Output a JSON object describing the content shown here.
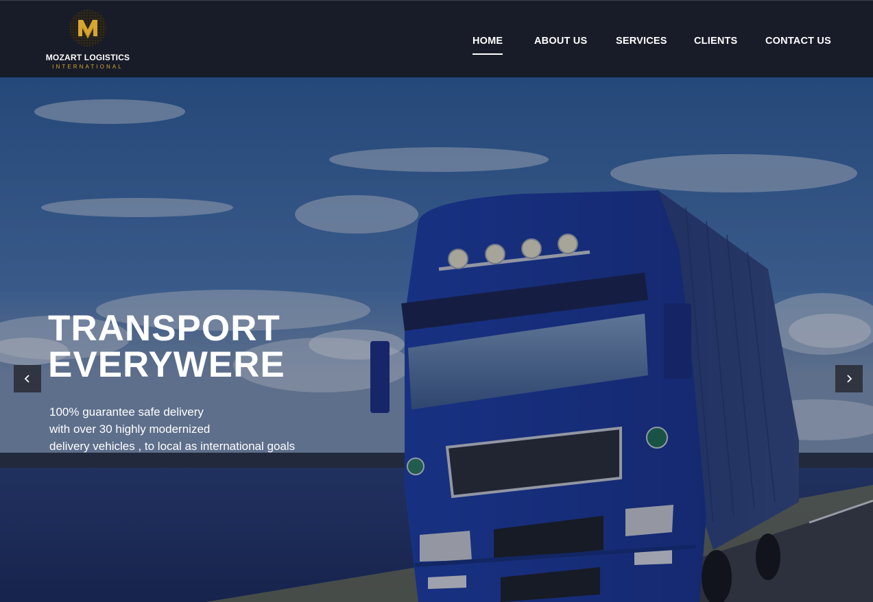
{
  "brand": {
    "name": "MOZART LOGISTICS",
    "subtitle": "INTERNATIONAL",
    "mark_letter": "M",
    "accent_color": "#d7a531",
    "header_bg": "#171c28"
  },
  "nav": {
    "items": [
      {
        "label": "HOME",
        "active": true
      },
      {
        "label": "ABOUT US",
        "active": false
      },
      {
        "label": "SERVICES",
        "active": false
      },
      {
        "label": "CLIENTS",
        "active": false
      },
      {
        "label": "CONTACT US",
        "active": false
      }
    ]
  },
  "hero": {
    "title_line1": "TRANSPORT",
    "title_line2": "EVERYWERE",
    "text_line1": "100% guarantee safe delivery",
    "text_line2": "with over 30 highly modernized",
    "text_line3": "delivery vehicles , to local as international goals",
    "prev_icon": "chevron-left-icon",
    "next_icon": "chevron-right-icon"
  }
}
